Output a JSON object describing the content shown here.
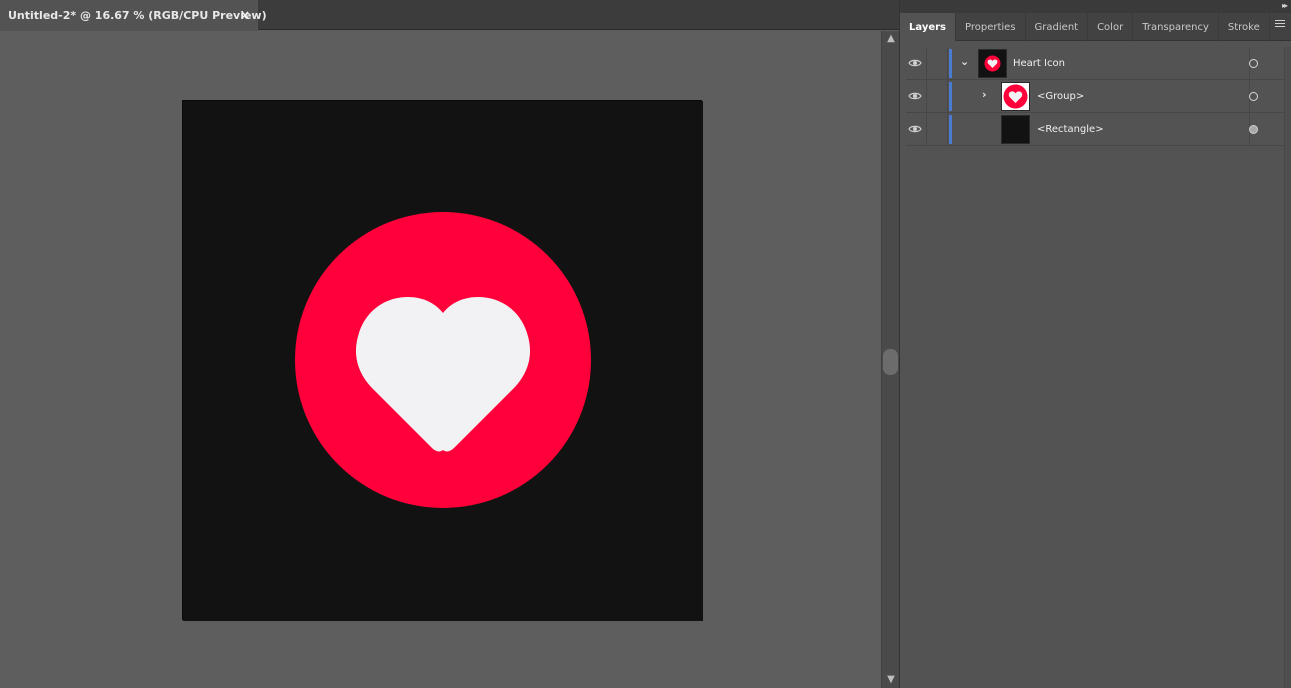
{
  "document": {
    "tab_title": "Untitled-2* @ 16.67 % (RGB/CPU Preview)",
    "close_glyph": "×"
  },
  "artwork": {
    "background_color": "#121212",
    "circle_color": "#ff003a",
    "heart_color": "#f2f2f4"
  },
  "scrollbar": {
    "up_glyph": "▲",
    "down_glyph": "▼"
  },
  "panel": {
    "collapse_glyph": "▸▸",
    "tabs": [
      {
        "label": "Layers",
        "active": true
      },
      {
        "label": "Properties"
      },
      {
        "label": "Gradient"
      },
      {
        "label": "Color"
      },
      {
        "label": "Transparency"
      },
      {
        "label": "Stroke"
      }
    ]
  },
  "layers": [
    {
      "name": "Heart Icon",
      "twist": "⌄",
      "thumb": "heart-small",
      "target": "open"
    },
    {
      "name": "<Group>",
      "twist": "›",
      "thumb": "heart-large",
      "target": "open"
    },
    {
      "name": "<Rectangle>",
      "twist": "",
      "thumb": "rect",
      "target": "filled"
    }
  ],
  "colors": {
    "layer_bar": "#4a7bd0",
    "accent_red": "#ff003a"
  }
}
